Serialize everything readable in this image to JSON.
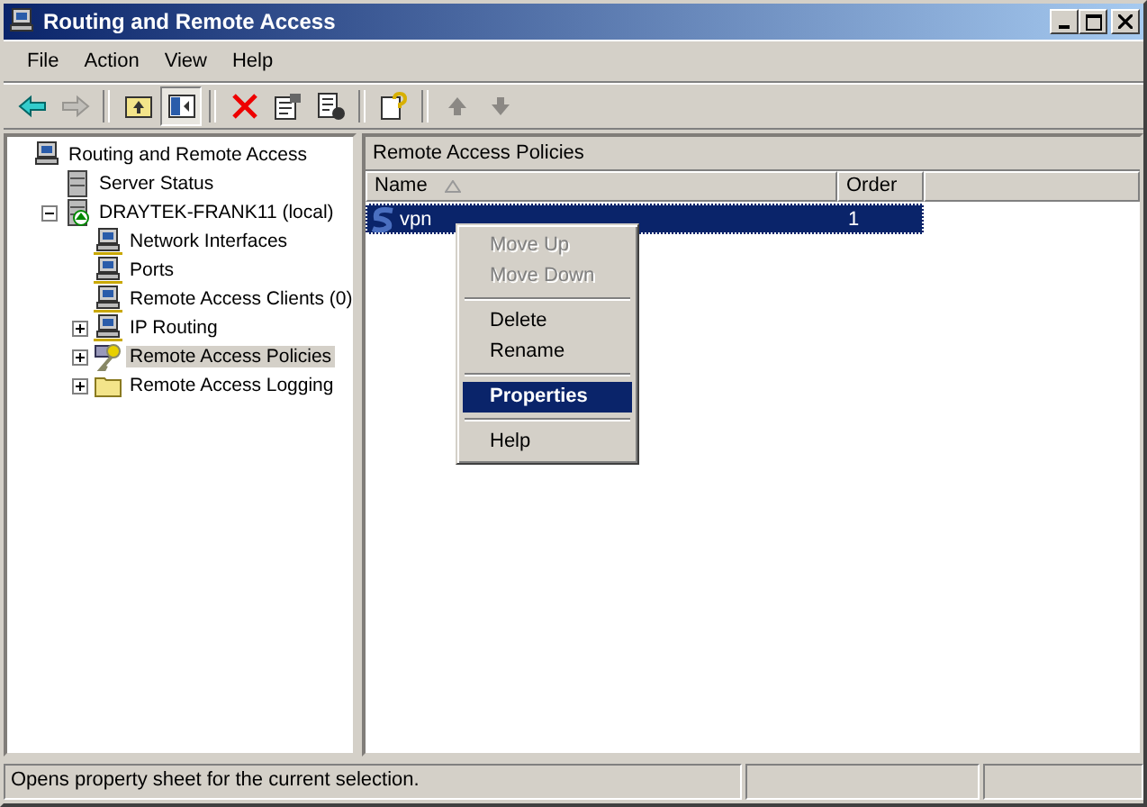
{
  "window": {
    "title": "Routing and Remote Access"
  },
  "menu_bar": [
    "File",
    "Action",
    "View",
    "Help"
  ],
  "toolbar": [
    {
      "kind": "back",
      "disabled": false,
      "pressed": false
    },
    {
      "kind": "forward",
      "disabled": true,
      "pressed": false
    },
    {
      "kind": "sep"
    },
    {
      "kind": "up-folder",
      "disabled": false,
      "pressed": false
    },
    {
      "kind": "tree-toggle",
      "disabled": false,
      "pressed": true
    },
    {
      "kind": "sep"
    },
    {
      "kind": "delete",
      "disabled": false,
      "pressed": false
    },
    {
      "kind": "properties",
      "disabled": false,
      "pressed": false
    },
    {
      "kind": "export",
      "disabled": false,
      "pressed": false
    },
    {
      "kind": "sep"
    },
    {
      "kind": "help",
      "disabled": false,
      "pressed": false
    },
    {
      "kind": "sep"
    },
    {
      "kind": "move-up",
      "disabled": true,
      "pressed": false
    },
    {
      "kind": "move-down",
      "disabled": true,
      "pressed": false
    }
  ],
  "tree": [
    {
      "label": "Routing and Remote Access",
      "kind": "computer",
      "selected": false,
      "children": [
        {
          "label": "Server Status",
          "kind": "server",
          "selected": false
        },
        {
          "label": "DRAYTEK-FRANK11 (local)",
          "kind": "server-up",
          "selected": false,
          "expanded": true,
          "children": [
            {
              "label": "Network Interfaces",
              "kind": "network",
              "selected": false
            },
            {
              "label": "Ports",
              "kind": "network",
              "selected": false
            },
            {
              "label": "Remote Access Clients (0)",
              "kind": "network",
              "selected": false
            },
            {
              "label": "IP Routing",
              "kind": "network",
              "selected": false,
              "expanded": false
            },
            {
              "label": "Remote Access Policies",
              "kind": "key",
              "selected": true,
              "expanded": false
            },
            {
              "label": "Remote Access Logging",
              "kind": "folder",
              "selected": false,
              "expanded": false
            }
          ]
        }
      ]
    }
  ],
  "details": {
    "title": "Remote Access Policies",
    "columns": [
      "Name",
      "Order"
    ],
    "rows": [
      {
        "name": "vpn",
        "order": "1",
        "selected": true
      }
    ]
  },
  "context_menu": [
    {
      "kind": "item",
      "label": "Move Up",
      "disabled": true,
      "selected": false
    },
    {
      "kind": "item",
      "label": "Move Down",
      "disabled": true,
      "selected": false
    },
    {
      "kind": "separator"
    },
    {
      "kind": "item",
      "label": "Delete",
      "disabled": false,
      "selected": false
    },
    {
      "kind": "item",
      "label": "Rename",
      "disabled": false,
      "selected": false
    },
    {
      "kind": "separator"
    },
    {
      "kind": "item",
      "label": "Properties",
      "disabled": false,
      "selected": true
    },
    {
      "kind": "separator"
    },
    {
      "kind": "item",
      "label": "Help",
      "disabled": false,
      "selected": false
    }
  ],
  "status_bar": {
    "text": "Opens property sheet for the current selection."
  }
}
